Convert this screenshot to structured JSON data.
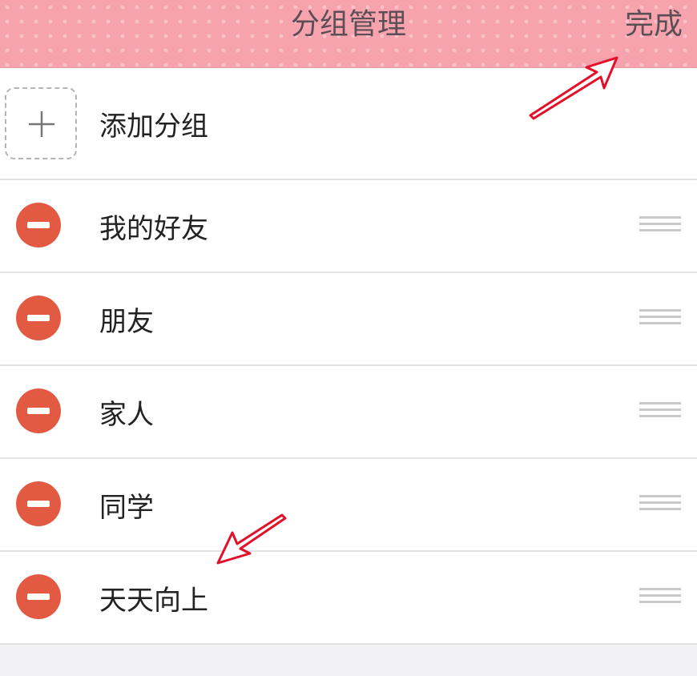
{
  "header": {
    "title": "分组管理",
    "done_label": "完成"
  },
  "add_group": {
    "label": "添加分组"
  },
  "groups": [
    {
      "label": "我的好友"
    },
    {
      "label": "朋友"
    },
    {
      "label": "家人"
    },
    {
      "label": "同学"
    },
    {
      "label": "天天向上"
    }
  ],
  "colors": {
    "header_pink": "#f7a3ae",
    "delete_red": "#e35a43",
    "annotation_arrow": "#e3102a"
  },
  "icons": {
    "add": "plus-icon",
    "delete": "minus-circle-icon",
    "reorder": "drag-handle-icon",
    "annotation": "red-arrow-annotation"
  }
}
